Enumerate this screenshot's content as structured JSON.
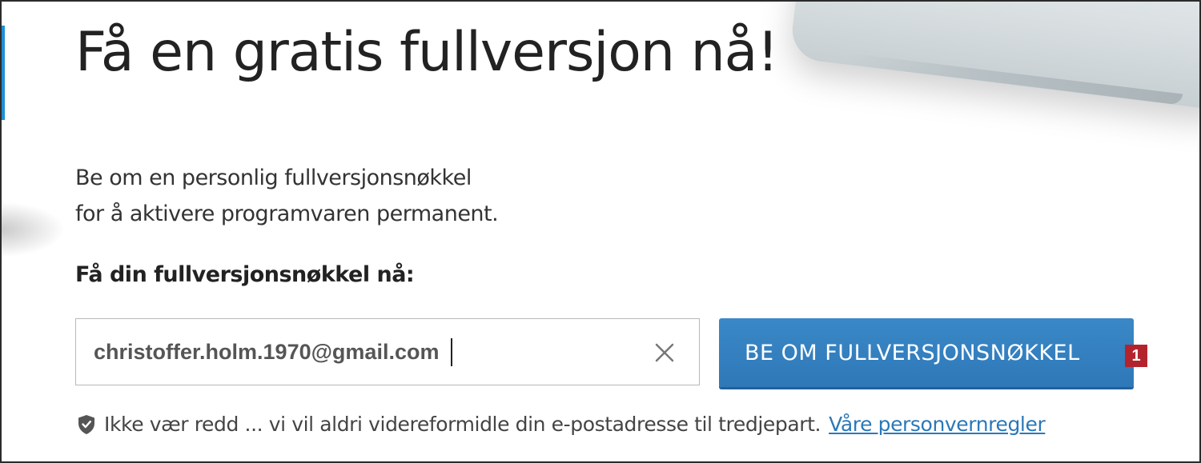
{
  "hero": {
    "title": "Få en gratis fullversjon nå!",
    "description_line1": "Be om en personlig fullversjonsnøkkel",
    "description_line2": "for å aktivere programvaren permanent."
  },
  "form": {
    "label": "Få din fullversjonsnøkkel nå:",
    "email_value": "christoffer.holm.1970@gmail.com",
    "clear_icon": "close-icon",
    "submit_label": "BE OM FULLVERSJONSNØKKEL"
  },
  "annotation": {
    "step_number": "1",
    "color": "#b3232e"
  },
  "privacy": {
    "icon": "shield-icon",
    "text": "Ikke vær redd ... vi vil aldri videreformidle din e-postadresse til tredjepart.",
    "link_label": "Våre personvernregler"
  },
  "colors": {
    "accent": "#2f78b8",
    "link": "#2b78b9",
    "text": "#222222"
  }
}
